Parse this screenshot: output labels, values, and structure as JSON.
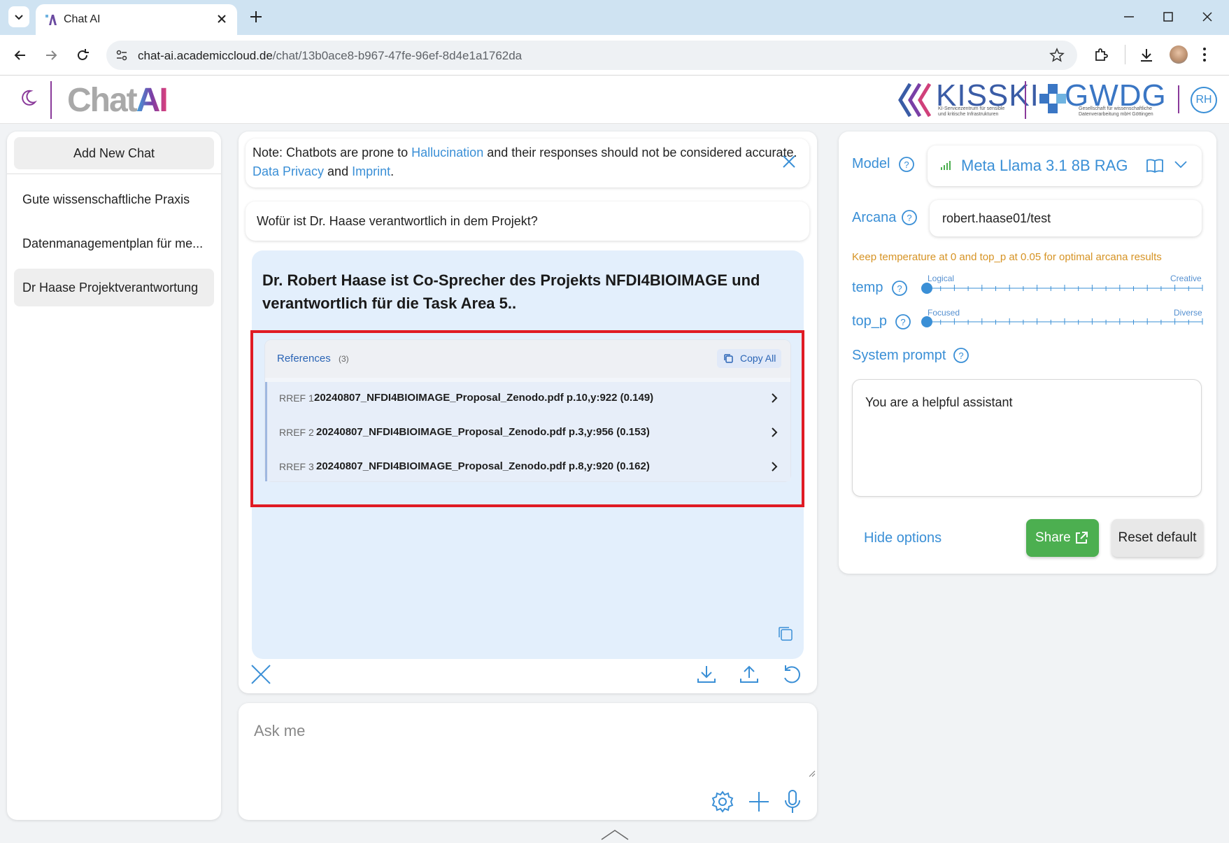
{
  "browser": {
    "tab_title": "Chat AI",
    "url_host": "chat-ai.academiccloud.de",
    "url_path": "/chat/13b0ace8-b967-47fe-96ef-8d4e1a1762da"
  },
  "header": {
    "logo_text_chat": "Chat",
    "logo_text_ai": "AI",
    "kisski_text": "KISSKI",
    "kisski_sub1": "KI-Servicezentrum für sensible",
    "kisski_sub2": "und kritische Infrastrukturen",
    "gwdg_text": "GWDG",
    "gwdg_sub1": "Gesellschaft für wissenschaftliche",
    "gwdg_sub2": "Datenverarbeitung mbH Göttingen",
    "avatar_initials": "RH"
  },
  "sidebar": {
    "add_new_chat": "Add New Chat",
    "items": [
      {
        "label": "Gute wissenschaftliche Praxis"
      },
      {
        "label": "Datenmanagementplan für me..."
      },
      {
        "label": "Dr Haase Projektverantwortung"
      }
    ]
  },
  "chat": {
    "note_prefix": "Note: Chatbots are prone to ",
    "note_link1": "Hallucination",
    "note_mid": " and their responses should not be considered accurate. ",
    "note_link2": "Data Privacy",
    "note_and": " and ",
    "note_link3": "Imprint",
    "note_end": ".",
    "user_message": "Wofür ist Dr. Haase verantwortlich in dem Projekt?",
    "bot_message": "Dr. Robert Haase ist Co-Sprecher des Projekts NFDI4BIOIMAGE und verantwortlich für die Task Area 5..",
    "references_title": "References",
    "references_count": "(3)",
    "copy_all": "Copy All",
    "references": [
      {
        "tag": "RREF 1",
        "name": "20240807_NFDI4BIOIMAGE_Proposal_Zenodo.pdf p.10,y:922 (0.149)"
      },
      {
        "tag": "RREF 2",
        "name": "20240807_NFDI4BIOIMAGE_Proposal_Zenodo.pdf p.3,y:956 (0.153)"
      },
      {
        "tag": "RREF 3",
        "name": "20240807_NFDI4BIOIMAGE_Proposal_Zenodo.pdf p.8,y:920 (0.162)"
      }
    ],
    "input_placeholder": "Ask me"
  },
  "options": {
    "model_label": "Model",
    "model_value": "Meta Llama 3.1 8B RAG",
    "arcana_label": "Arcana",
    "arcana_value": "robert.haase01/test",
    "hint": "Keep temperature at 0 and top_p at 0.05 for optimal arcana results",
    "temp_label": "temp",
    "temp_min_label": "Logical",
    "temp_max_label": "Creative",
    "temp_value": 0,
    "top_p_label": "top_p",
    "top_p_min_label": "Focused",
    "top_p_max_label": "Diverse",
    "top_p_value": 0.05,
    "system_prompt_label": "System prompt",
    "system_prompt_value": "You are a helpful assistant",
    "hide_options": "Hide options",
    "share": "Share",
    "reset_default": "Reset default"
  },
  "colors": {
    "accent": "#3a8fd6",
    "highlight": "#e01b24",
    "share_green": "#4caf50",
    "hint_orange": "#d69324"
  }
}
